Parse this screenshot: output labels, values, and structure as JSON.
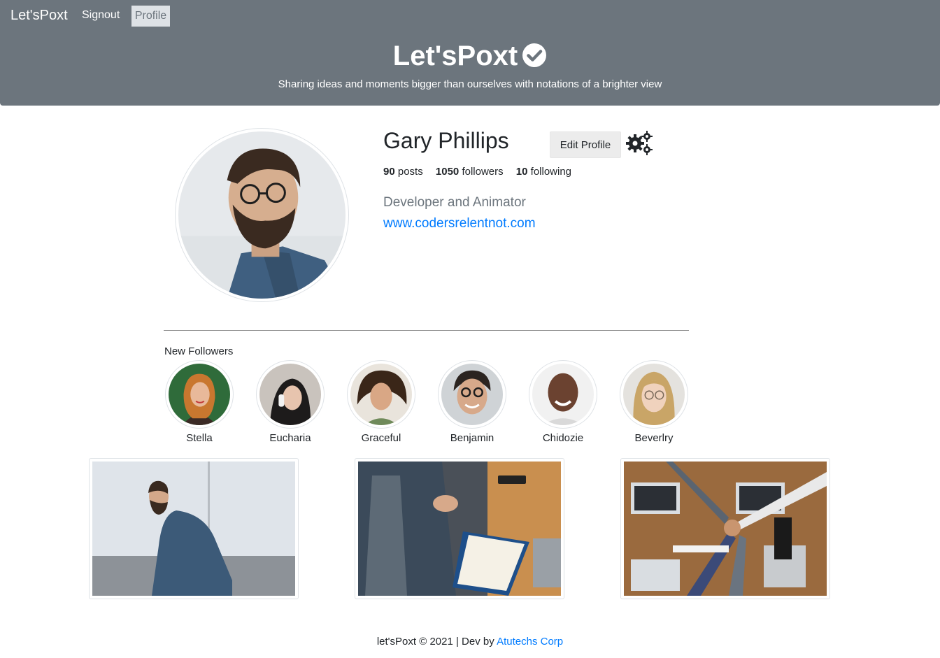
{
  "nav": {
    "brand": "Let'sPoxt",
    "signout": "Signout",
    "profile": "Profile"
  },
  "hero": {
    "title": "Let'sPoxt",
    "subtitle": "Sharing ideas and moments bigger than ourselves with notations of a brighter view",
    "verified_icon": "check-circle-icon"
  },
  "profile": {
    "name": "Gary Phillips",
    "edit_label": "Edit Profile",
    "settings_icon": "gears-icon",
    "posts_count": "90",
    "posts_label": "posts",
    "followers_count": "1050",
    "followers_label": "followers",
    "following_count": "10",
    "following_label": "following",
    "bio": "Developer and Animator",
    "website": "www.codersrelentnot.com"
  },
  "followers": {
    "heading": "New Followers",
    "items": [
      {
        "name": "Stella"
      },
      {
        "name": "Eucharia"
      },
      {
        "name": "Graceful"
      },
      {
        "name": "Benjamin"
      },
      {
        "name": "Chidozie"
      },
      {
        "name": "Beverlry"
      }
    ]
  },
  "footer": {
    "text": "let'sPoxt © 2021 | Dev by",
    "link": "Atutechs Corp"
  },
  "colors": {
    "header_bg": "#6c757d",
    "link": "#007bff",
    "active_tab_bg": "#dee2e6"
  }
}
